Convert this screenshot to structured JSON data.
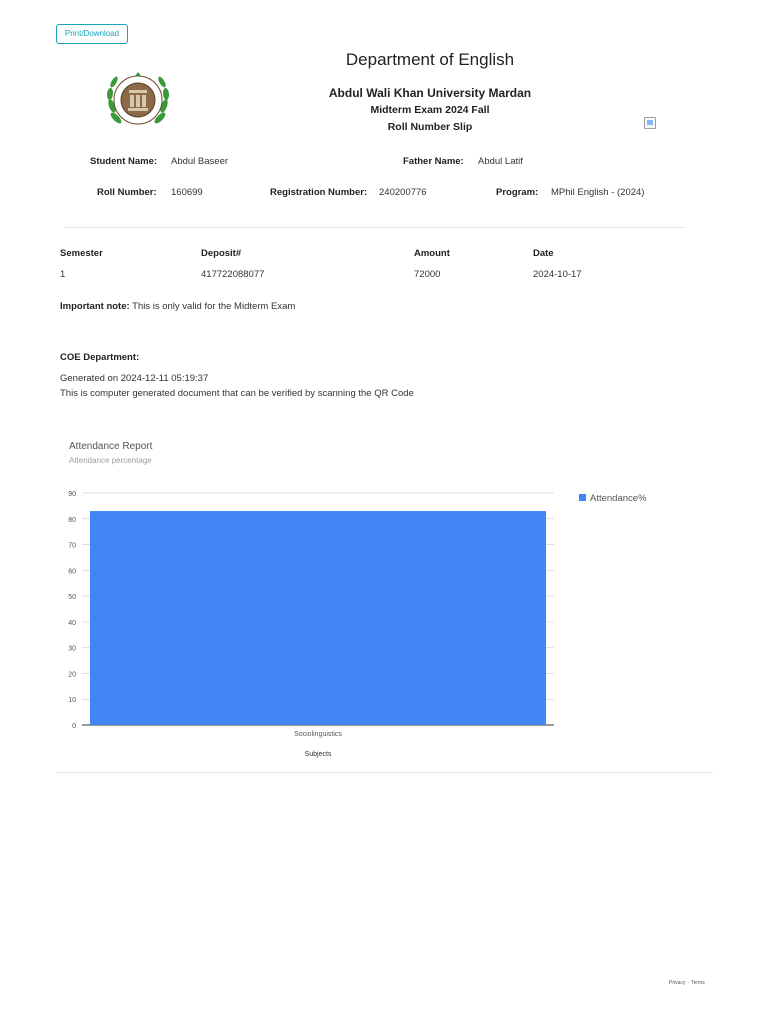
{
  "toolbar": {
    "print_label": "Print/Download"
  },
  "header": {
    "department": "Department of English",
    "university": "Abdul Wali Khan University Mardan",
    "exam": "Midterm Exam 2024 Fall",
    "slip_title": "Roll Number Slip"
  },
  "student": {
    "name_label": "Student Name:",
    "name": "Abdul Baseer",
    "father_label": "Father Name:",
    "father": "Abdul Latif",
    "roll_label": "Roll Number:",
    "roll": "160699",
    "reg_label": "Registration Number:",
    "reg": "240200776",
    "program_label": "Program:",
    "program": "MPhil English - (2024)"
  },
  "fee_table": {
    "headers": [
      "Semester",
      "Deposit#",
      "Amount",
      "Date"
    ],
    "rows": [
      [
        "1",
        "417722088077",
        "72000",
        "2024-10-17"
      ]
    ]
  },
  "note": {
    "label": "Important note:",
    "text": " This is only valid for the Midterm Exam"
  },
  "coe": {
    "heading": "COE Department:",
    "generated": "Generated on 2024-12-11 05:19:37",
    "verify": "This is computer generated document that can be verified by scanning the QR Code"
  },
  "chart_data": {
    "type": "bar",
    "title": "Attendance Report",
    "subtitle": "Attendance percentage",
    "categories": [
      "Sociolinguistics"
    ],
    "series": [
      {
        "name": "Attendance%",
        "values": [
          83
        ],
        "color": "#4285f4"
      }
    ],
    "xlabel": "Subjects",
    "ylabel": "",
    "ylim": [
      0,
      90
    ],
    "yticks": [
      0,
      10,
      20,
      30,
      40,
      50,
      60,
      70,
      80,
      90
    ],
    "grid": true,
    "legend": "right"
  },
  "footer": {
    "privacy": "Privacy",
    "sep": "-",
    "terms": "Terms"
  }
}
